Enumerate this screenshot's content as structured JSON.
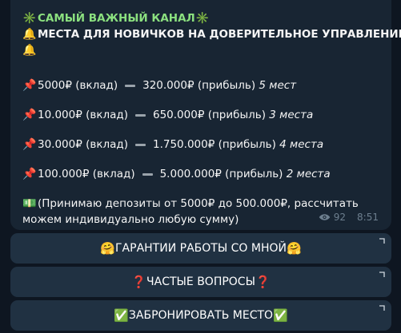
{
  "message": {
    "title_icon": "✳️",
    "title": "САМЫЙ ВАЖНЫЙ КАНАЛ",
    "title_icon_end": "✳️",
    "subtitle_icon": "🔔",
    "subtitle": "МЕСТА ДЛЯ НОВИЧКОВ НА ДОВЕРИТЕЛЬНОЕ УПРАВЛЕНИЕ",
    "subtitle_icon_2": "🔔",
    "offers": [
      {
        "icon": "📌",
        "deposit": "5000₽ (вклад)",
        "profit": "320.000₽ (прибыль)",
        "slots": "5 мест"
      },
      {
        "icon": "📌",
        "deposit": "10.000₽ (вклад)",
        "profit": "650.000₽ (прибыль)",
        "slots": "3 места"
      },
      {
        "icon": "📌",
        "deposit": "30.000₽ (вклад)",
        "profit": "1.750.000₽ (прибыль)",
        "slots": "4 места"
      },
      {
        "icon": "📌",
        "deposit": "100.000₽ (вклад)",
        "profit": "5.000.000₽ (прибыль)",
        "slots": "2 места"
      }
    ],
    "deposit_note_icon": "💵",
    "deposit_note_line1": "(Принимаю депозиты от 5000₽ до 500.000₽, рассчитать",
    "deposit_note_line2": "можем индивидуально любую сумму)",
    "views": "92",
    "time": "8:51"
  },
  "buttons": [
    {
      "icon_left": "🤗",
      "label": "ГАРАНТИИ РАБОТЫ СО МНОЙ",
      "icon_right": "🤗"
    },
    {
      "icon_left": "❓",
      "label": "ЧАСТЫЕ ВОПРОСЫ",
      "icon_right": "❓"
    },
    {
      "icon_left": "✅",
      "label": "ЗАБРОНИРОВАТЬ МЕСТО",
      "icon_right": "✅"
    }
  ],
  "icons": {
    "views": "eye-icon",
    "button_corner": "arrow-corner-icon"
  },
  "colors": {
    "background": "#0e1621",
    "bubble": "#182533",
    "title_green": "#8be07f",
    "button_bg": "#203142",
    "meta_gray": "#6d7f8f"
  }
}
